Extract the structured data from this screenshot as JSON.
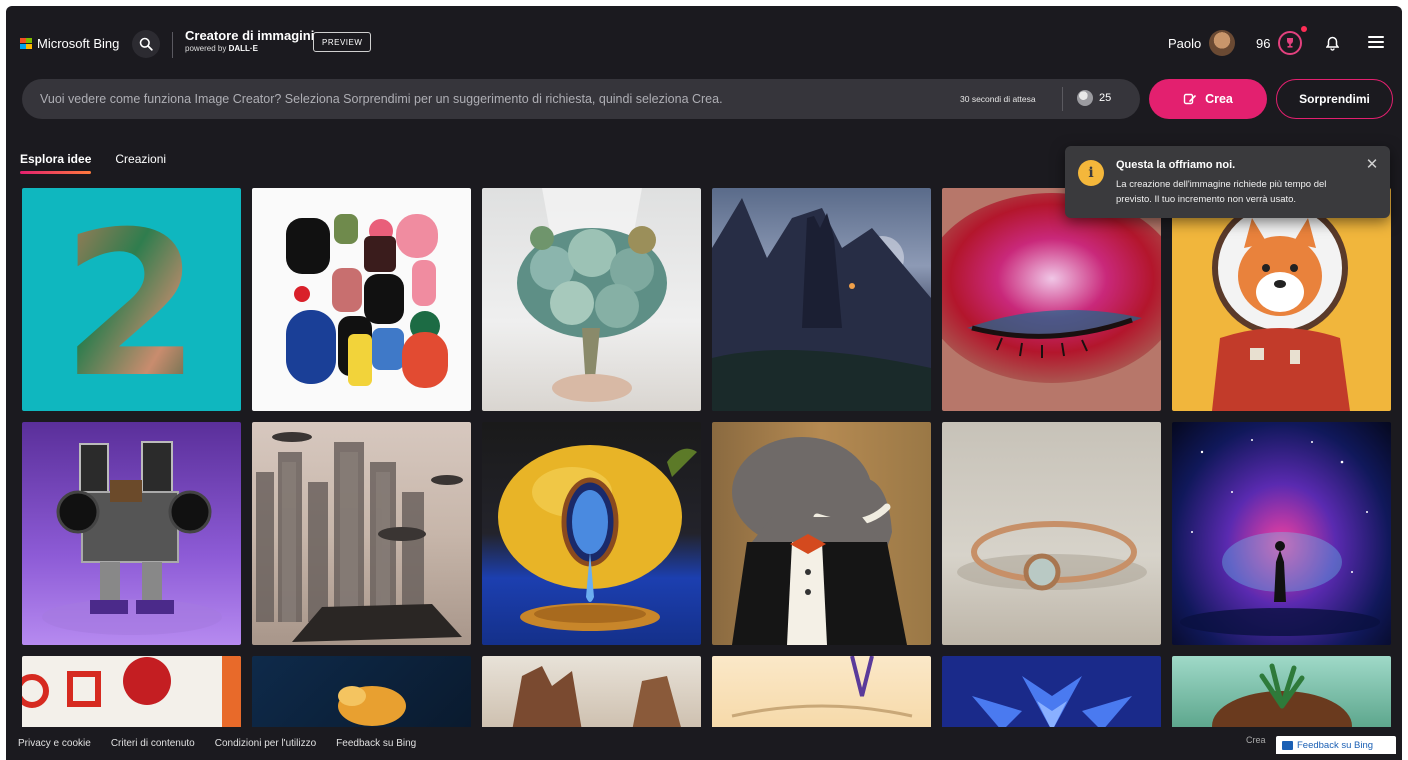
{
  "header": {
    "brand": "Microsoft Bing",
    "title": "Creatore di immagini",
    "subtitle_prefix": "powered by",
    "subtitle_brand": "DALL·E",
    "preview_badge": "PREVIEW",
    "user_name": "Paolo",
    "points": "96",
    "colors": {
      "ms_red": "#f25022",
      "ms_green": "#7fba00",
      "ms_blue": "#00a4ef",
      "ms_yellow": "#ffb900"
    }
  },
  "prompt": {
    "placeholder": "Vuoi vedere come funziona Image Creator? Seleziona Sorprendimi per un suggerimento di richiesta, quindi seleziona Crea.",
    "wait_text": "30 secondi di attesa",
    "boosts": "25",
    "create_label": "Crea",
    "surprise_label": "Sorprendimi",
    "accent": "#e3206f"
  },
  "tabs": [
    {
      "label": "Esplora idee",
      "active": true
    },
    {
      "label": "Creazioni",
      "active": false
    }
  ],
  "toast": {
    "icon": "info-icon",
    "title": "Questa la offriamo noi.",
    "body": "La creazione dell'immagine richiede più tempo del previsto. Il tuo incremento non verrà usato."
  },
  "footer": {
    "links": [
      "Privacy e cookie",
      "Criteri di contenuto",
      "Condizioni per l'utilizzo",
      "Feedback su Bing"
    ],
    "right_text": "Crea",
    "feedback_button": "Feedback su Bing"
  }
}
